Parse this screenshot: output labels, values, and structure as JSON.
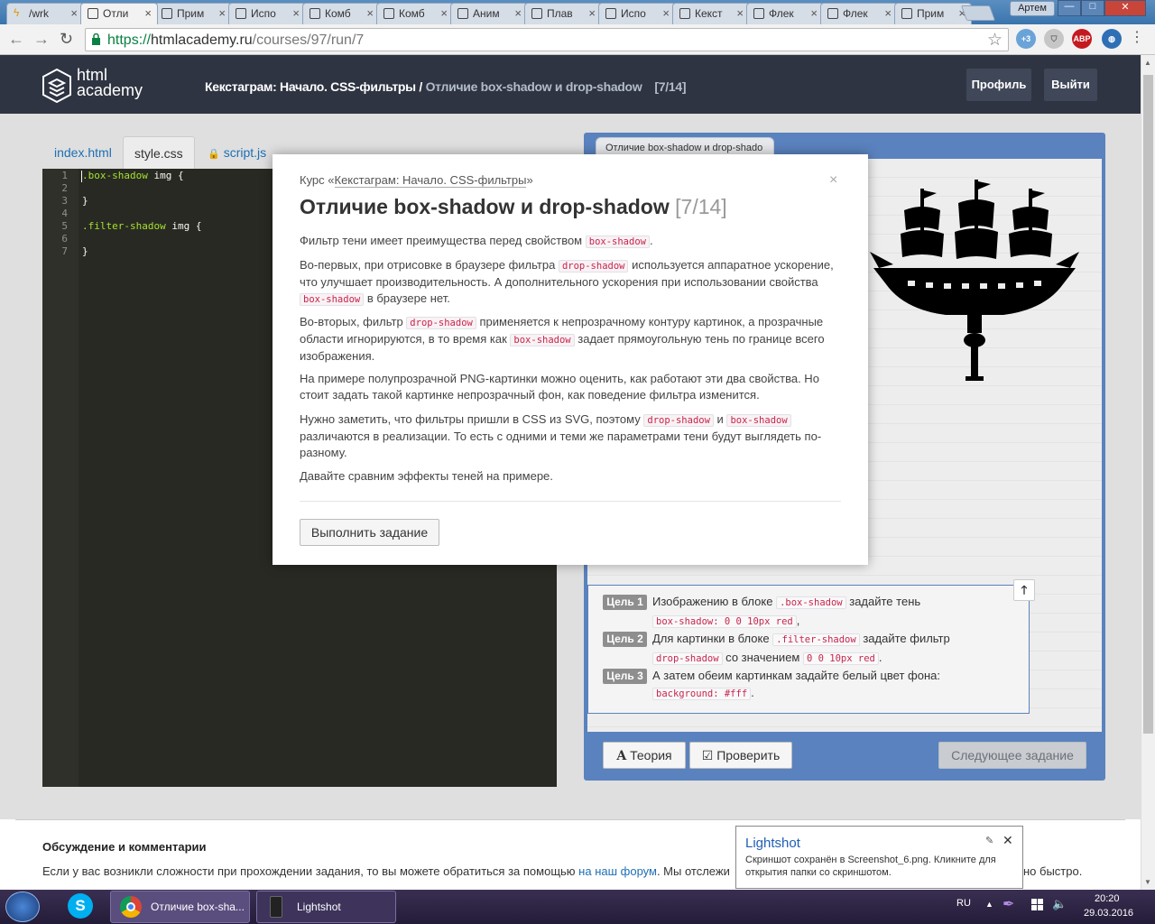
{
  "browser": {
    "tabs": [
      {
        "label": "/wrk",
        "icon": "bolt-icon"
      },
      {
        "label": "Отли",
        "icon": "htmlacademy-icon"
      },
      {
        "label": "Прим",
        "icon": "htmlacademy-icon"
      },
      {
        "label": "Испо",
        "icon": "htmlacademy-icon"
      },
      {
        "label": "Комб",
        "icon": "htmlacademy-icon"
      },
      {
        "label": "Комб",
        "icon": "htmlacademy-icon"
      },
      {
        "label": "Аним",
        "icon": "htmlacademy-icon"
      },
      {
        "label": "Плав",
        "icon": "htmlacademy-icon"
      },
      {
        "label": "Испо",
        "icon": "htmlacademy-icon"
      },
      {
        "label": "Кекст",
        "icon": "htmlacademy-icon"
      },
      {
        "label": "Флек",
        "icon": "htmlacademy-icon"
      },
      {
        "label": "Флек",
        "icon": "htmlacademy-icon"
      },
      {
        "label": "Прим",
        "icon": "htmlacademy-icon"
      }
    ],
    "user": "Артем",
    "url_scheme": "https://",
    "url_host": "htmlacademy.ru",
    "url_path": "/courses/97/run/7",
    "ext_badge": "+3",
    "ext_abp": "ABP"
  },
  "header": {
    "logo_line1": "html",
    "logo_line2": "academy",
    "course": "Кекстаграм: Начало. CSS-фильтры",
    "separator": " / ",
    "lesson": "Отличие box-shadow и drop-shadow",
    "step": "[7/14]",
    "profile": "Профиль",
    "logout": "Выйти"
  },
  "editor": {
    "tabs": {
      "index": "index.html",
      "style": "style.css",
      "script": "script.js"
    },
    "lines": [
      {
        "n": "1",
        "sel": ".box-shadow",
        "rest": " img {"
      },
      {
        "n": "2",
        "sel": "",
        "rest": ""
      },
      {
        "n": "3",
        "sel": "",
        "rest": "}"
      },
      {
        "n": "4",
        "sel": "",
        "rest": ""
      },
      {
        "n": "5",
        "sel": ".filter-shadow",
        "rest": " img {"
      },
      {
        "n": "6",
        "sel": "",
        "rest": ""
      },
      {
        "n": "7",
        "sel": "",
        "rest": "}"
      }
    ]
  },
  "preview": {
    "tab_title": "Отличие box-shadow и drop-shado",
    "goals": [
      {
        "badge": "Цель 1",
        "t1": "Изображению в блоке",
        "c1": ".box-shadow",
        "t2": "задайте тень",
        "c2": "box-shadow: 0 0 10px red",
        "t3": ","
      },
      {
        "badge": "Цель 2",
        "t1": "Для картинки в блоке",
        "c1": ".filter-shadow",
        "t2": "задайте фильтр",
        "c2": "drop-shadow",
        "t3": "со значением",
        "c3": "0 0 10px red",
        "t4": "."
      },
      {
        "badge": "Цель 3",
        "t1": "А затем обеим картинкам задайте белый цвет фона:",
        "c1": "background: #fff",
        "t2": "."
      }
    ],
    "theory": "Теория",
    "check": "Проверить",
    "next": "Следующее задание"
  },
  "modal": {
    "course_prefix": "Курс «",
    "course_link": "Кекстаграм: Начало. CSS-фильтры",
    "course_suffix": "»",
    "title": "Отличие box-shadow и drop-shadow",
    "step": "[7/14]",
    "close": "×",
    "p1a": "Фильтр тени имеет преимущества перед свойством",
    "p1code": "box-shadow",
    "p1b": ".",
    "p2a": "Во-первых, при отрисовке в браузере фильтра",
    "p2code1": "drop-shadow",
    "p2b": "используется аппаратное ускорение, что улучшает производительность. А дополнительного ускорения при использовании свойства",
    "p2code2": "box-shadow",
    "p2c": "в браузере нет.",
    "p3a": "Во-вторых, фильтр",
    "p3code1": "drop-shadow",
    "p3b": "применяется к непрозрачному контуру картинок, а прозрачные области игнорируются, в то время как",
    "p3code2": "box-shadow",
    "p3c": "задает прямоугольную тень по границе всего изображения.",
    "p4": "На примере полупрозрачной PNG-картинки можно оценить, как работают эти два свойства. Но стоит задать такой картинке непрозрачный фон, как поведение фильтра изменится.",
    "p5a": "Нужно заметить, что фильтры пришли в CSS из SVG, поэтому",
    "p5code1": "drop-shadow",
    "p5b": "и",
    "p5code2": "box-shadow",
    "p5c": "различаются в реализации. То есть с одними и теми же параметрами тени будут выглядеть по-разному.",
    "p6": "Давайте сравним эффекты теней на примере.",
    "start": "Выполнить задание"
  },
  "discussion": {
    "title": "Обсуждение и комментарии",
    "text_a": "Если у вас возникли сложности при прохождении задания, то вы можете обратиться за помощью",
    "link": "на наш форум",
    "text_b": ". Мы отслежи",
    "tail": "но быстро."
  },
  "lightshot": {
    "title": "Lightshot",
    "text": "Скриншот сохранён в Screenshot_6.png. Кликните для открытия папки со скриншотом."
  },
  "taskbar": {
    "chrome_task": "Отличие box-sha...",
    "lightshot_task": "Lightshot",
    "lang": "RU",
    "time": "20:20",
    "date": "29.03.2016"
  },
  "colors": {
    "header_bg": "#2e3441",
    "preview_bg": "#5a82be",
    "code_color": "#c7254e",
    "link": "#1e6fb5"
  }
}
